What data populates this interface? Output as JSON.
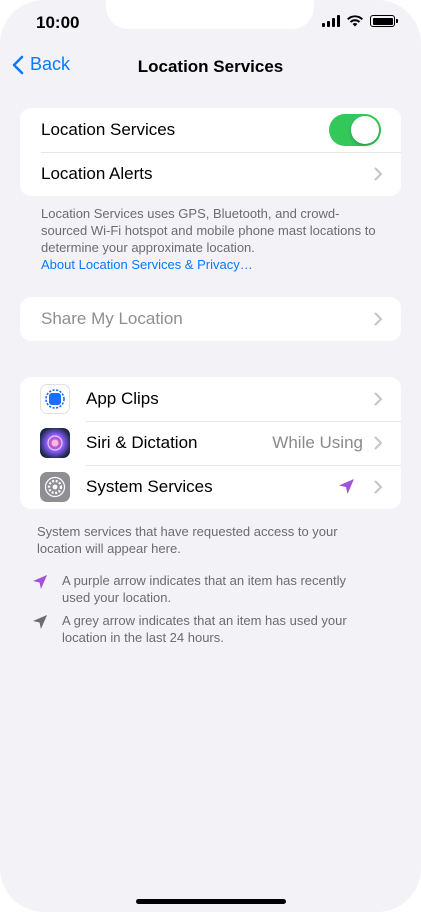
{
  "status_bar": {
    "time": "10:00"
  },
  "nav": {
    "back_label": "Back",
    "title": "Location Services"
  },
  "group1": {
    "location_services_label": "Location Services",
    "location_services_on": true,
    "location_alerts_label": "Location Alerts"
  },
  "group1_footer": {
    "text": "Location Services uses GPS, Bluetooth, and crowd-sourced Wi-Fi hotspot and mobile phone mast locations to determine your approximate location.",
    "link": "About Location Services & Privacy…"
  },
  "share": {
    "label": "Share My Location"
  },
  "apps": [
    {
      "label": "App Clips",
      "value": "",
      "icon": "app-clips-icon"
    },
    {
      "label": "Siri & Dictation",
      "value": "While Using",
      "icon": "siri-icon"
    },
    {
      "label": "System Services",
      "value": "",
      "icon": "gear-icon"
    }
  ],
  "apps_footer": {
    "text": "System services that have requested access to your location will appear here.",
    "purple_note": "A purple arrow indicates that an item has recently used your location.",
    "grey_note": "A grey arrow indicates that an item has used your location in the last 24 hours."
  },
  "colors": {
    "accent": "#0a7aff",
    "toggle_on": "#34c759",
    "purple_arrow": "#a550d9",
    "grey_arrow": "#8e8e93"
  }
}
